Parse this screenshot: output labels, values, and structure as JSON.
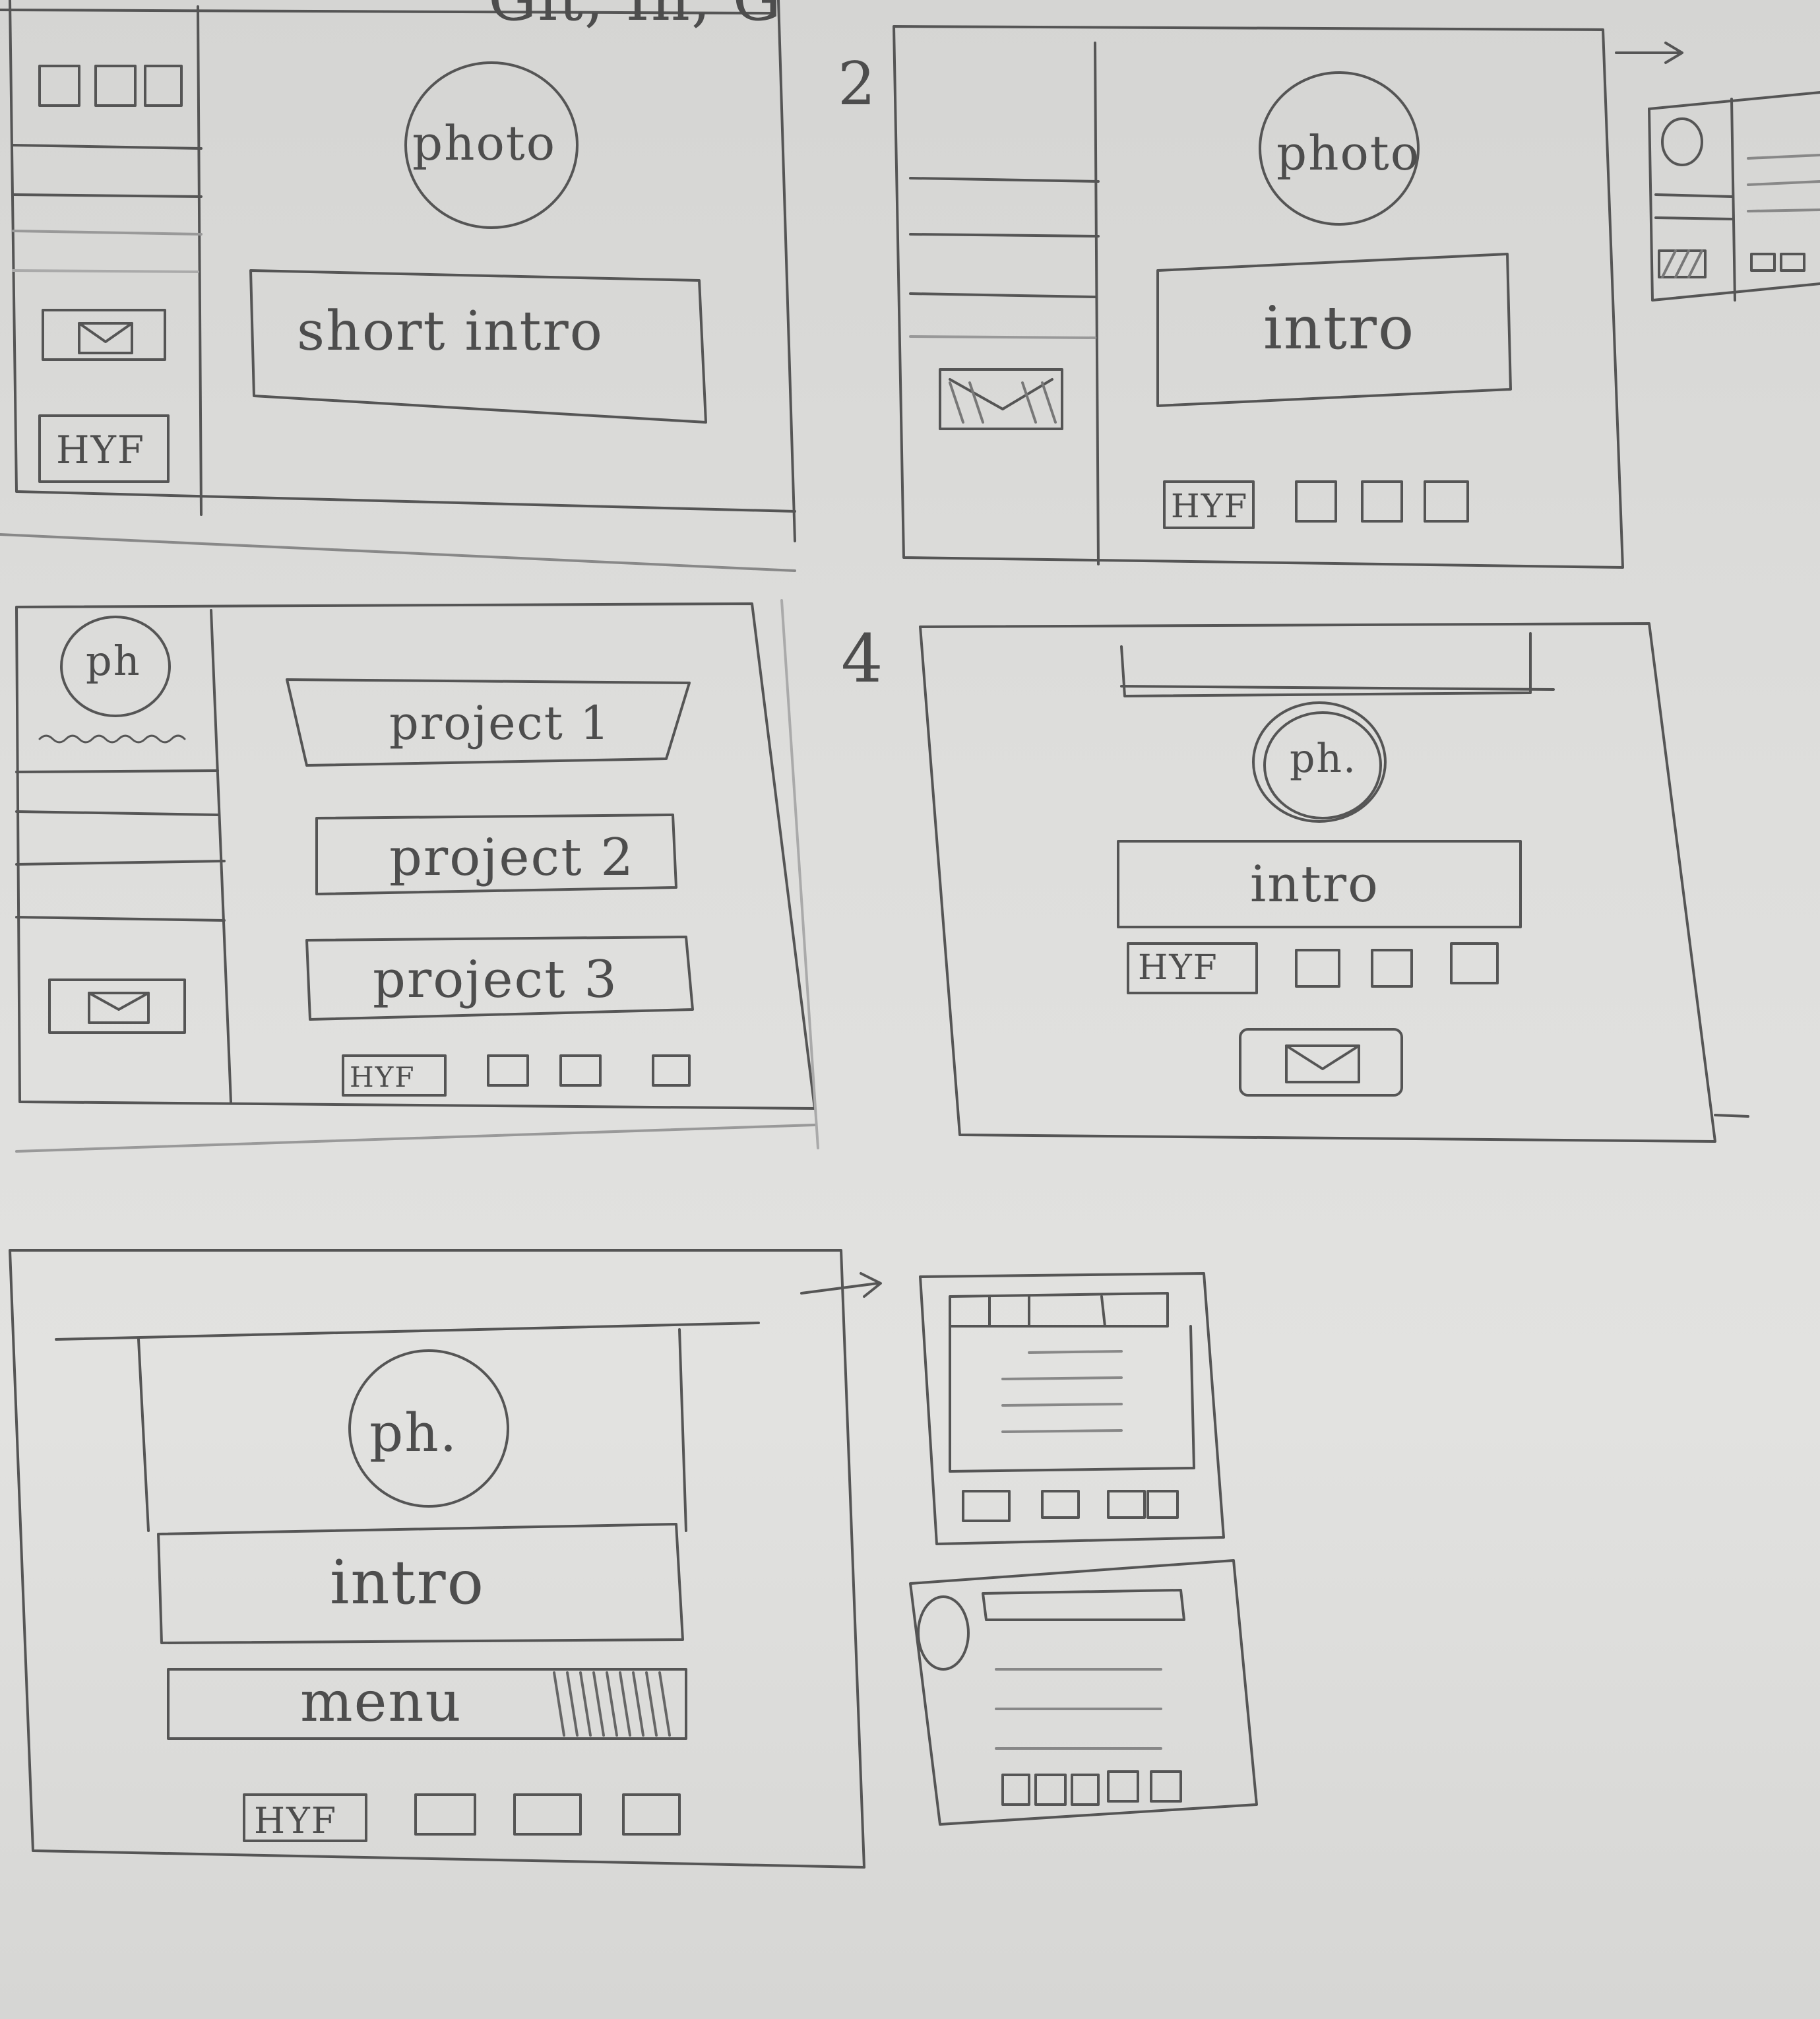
{
  "sheet": {
    "top_note": "Git, In, G",
    "sketch_numbers": [
      "2",
      "4"
    ]
  },
  "sketch1": {
    "photo": "photo",
    "intro": "short intro",
    "badge": "HYF"
  },
  "sketch2": {
    "photo": "photo",
    "intro": "intro",
    "badge": "HYF"
  },
  "sketch3": {
    "photo": "ph",
    "projects": [
      "project 1",
      "project 2",
      "project 3"
    ],
    "badge": "HYF"
  },
  "sketch4": {
    "photo": "ph.",
    "intro": "intro",
    "badge": "HYF"
  },
  "sketch5": {
    "photo": "ph.",
    "intro": "intro",
    "menu": "menu",
    "badge": "HYF"
  }
}
